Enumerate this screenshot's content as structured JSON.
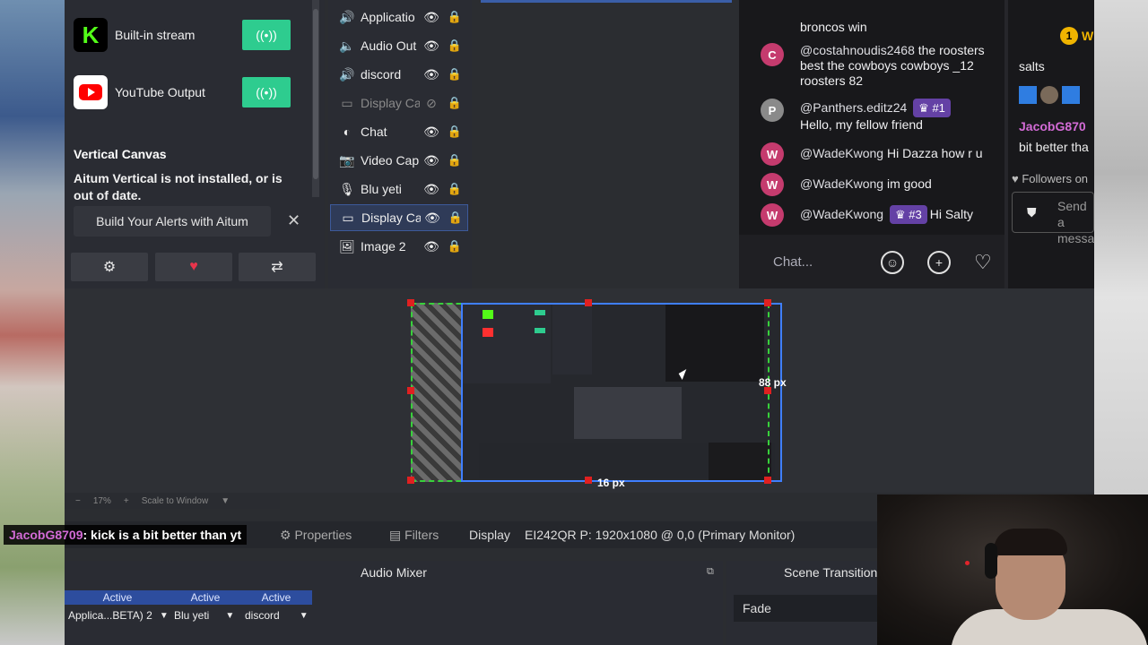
{
  "streams": [
    {
      "label": "Built-in stream",
      "icon": "kick-logo-icon",
      "color": "#53fc18"
    },
    {
      "label": "YouTube Output",
      "icon": "youtube-logo-icon",
      "color": "#ff0000"
    }
  ],
  "vertical_canvas": {
    "title": "Vertical Canvas",
    "note": "Aitum Vertical is not installed, or is out of date.",
    "alerts_button": "Build Your Alerts with Aitum",
    "close": "✕"
  },
  "sources": [
    {
      "name": "Applicatio",
      "icon": "audio-capture-icon",
      "visible": true
    },
    {
      "name": "Audio Out",
      "icon": "speaker-icon",
      "visible": true
    },
    {
      "name": "discord",
      "icon": "audio-capture-icon",
      "visible": true
    },
    {
      "name": "Display Ca",
      "icon": "monitor-icon",
      "visible": false
    },
    {
      "name": "Chat",
      "icon": "globe-icon",
      "visible": true
    },
    {
      "name": "Video Cap",
      "icon": "camera-icon",
      "visible": true
    },
    {
      "name": "Blu yeti",
      "icon": "microphone-icon",
      "visible": true
    },
    {
      "name": "Display Ca",
      "icon": "monitor-icon",
      "visible": true,
      "selected": true
    },
    {
      "name": "Image 2",
      "icon": "image-icon",
      "visible": true
    }
  ],
  "chat": {
    "messages": [
      {
        "text": "broncos win"
      },
      {
        "avatar": "C",
        "user": "@costahnoudis2468",
        "text": " the roosters best the cowboys cowboys _12 roosters 82"
      },
      {
        "avatar": "P",
        "user": "@Panthers.editz24",
        "badge": "#1",
        "text": "Hello, my fellow friend"
      },
      {
        "avatar": "W",
        "user": "@WadeKwong",
        "text": " Hi Dazza how r u"
      },
      {
        "avatar": "W",
        "user": "@WadeKwong",
        "text": " im good"
      },
      {
        "avatar": "W",
        "user": "@WadeKwong",
        "badge": "#3",
        "text": "Hi Salty"
      }
    ],
    "placeholder": "Chat...",
    "accent": "#6441a5"
  },
  "chat2": {
    "top_badge": "W",
    "line1": "salts",
    "user": "JacobG870",
    "line2": "bit better tha",
    "followers": "Followers on",
    "send": "Send a",
    "send2": "messa"
  },
  "preview": {
    "px_right": "88 px",
    "px_bottom": "16 px",
    "zoom": "17%",
    "scale": "Scale to Window"
  },
  "bottom": {
    "overlay_user": "JacobG8709",
    "overlay_text": ": kick is a bit better than yt",
    "properties": "Properties",
    "filters": "Filters",
    "display": "Display",
    "display_info": "EI242QR P: 1920x1080 @ 0,0 (Primary Monitor)"
  },
  "audio_mixer": {
    "title": "Audio Mixer",
    "channels": [
      {
        "status": "Active",
        "name": "Applica...BETA) 2"
      },
      {
        "status": "Active",
        "name": "Blu yeti"
      },
      {
        "status": "Active",
        "name": "discord"
      }
    ]
  },
  "scene_transitions": {
    "title": "Scene Transition",
    "current": "Fade"
  }
}
